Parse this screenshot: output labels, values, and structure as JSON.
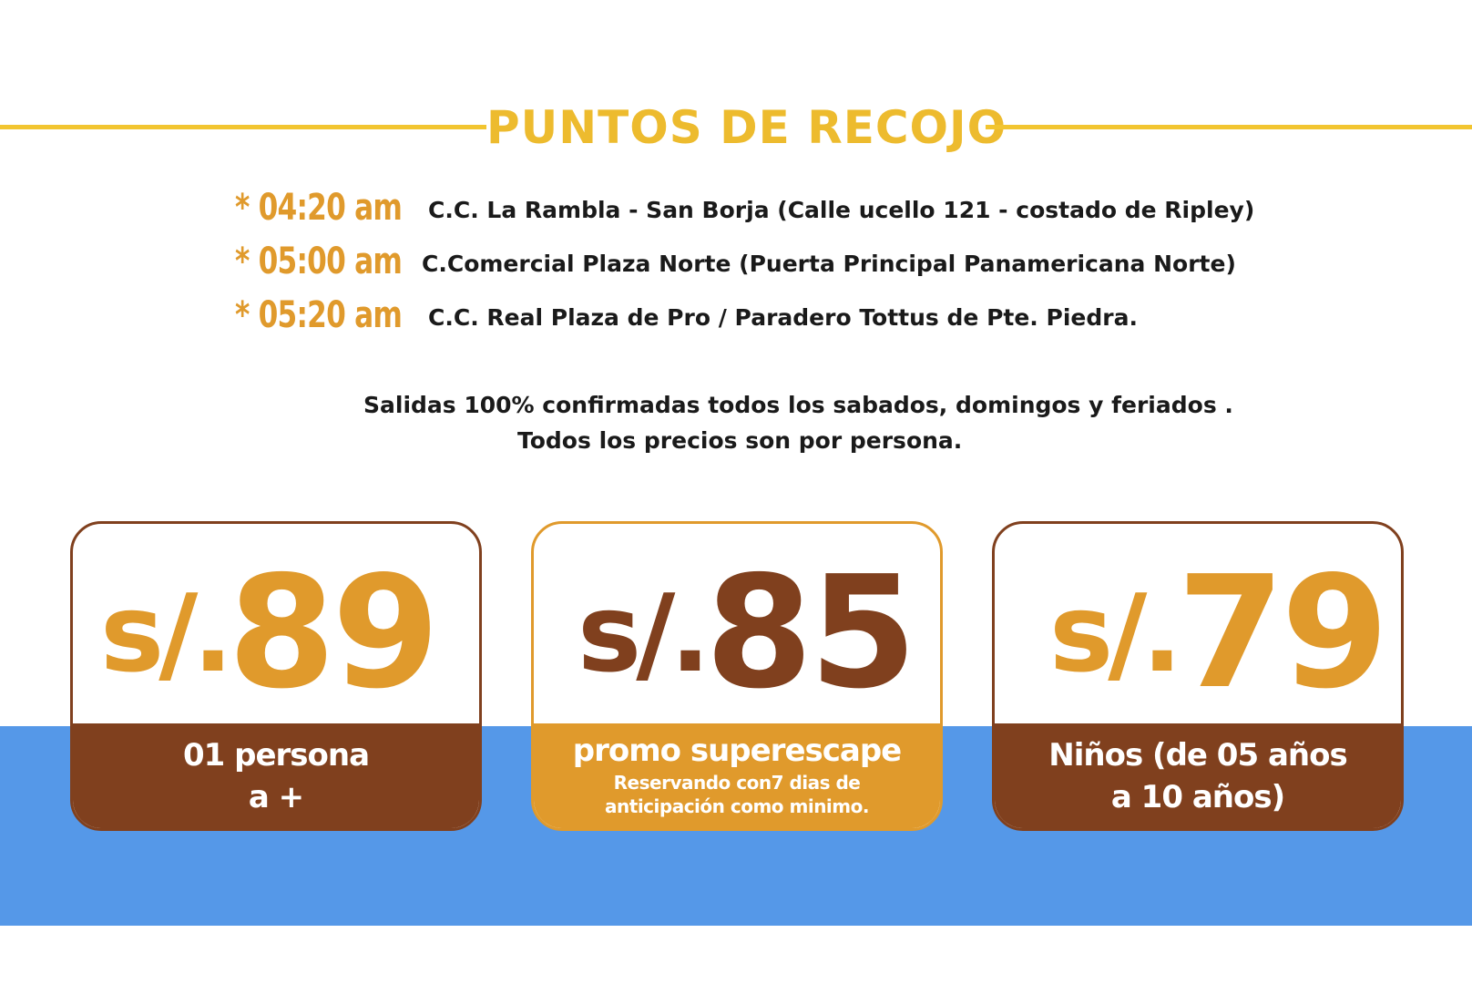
{
  "colors": {
    "gold": "#edbb2e",
    "orange": "#e09a2c",
    "brown": "#80401e",
    "blue": "#5598e8"
  },
  "header": {
    "title": "PUNTOS DE RECOJO"
  },
  "pickups": [
    {
      "time": "* 04:20 am",
      "place": "C.C. La Rambla - San Borja (Calle ucello 121 - costado de Ripley)"
    },
    {
      "time": "* 05:00 am",
      "place": "C.Comercial Plaza Norte (Puerta Principal Panamericana  Norte)"
    },
    {
      "time": "* 05:20 am",
      "place": "C.C. Real Plaza de Pro / Paradero Tottus de Pte. Piedra."
    }
  ],
  "notes": {
    "line1": "Salidas 100% confirmadas todos los sabados, domingos y feriados .",
    "line2": "Todos los precios son por persona."
  },
  "prices": [
    {
      "currency": "s/.",
      "amount": "89",
      "label": "01 persona",
      "label2": "a +"
    },
    {
      "currency": "s/.",
      "amount": "85",
      "label": "promo superescape",
      "label2": "Reservando con7 dias de",
      "label3": "anticipación como minimo."
    },
    {
      "currency": "s/.",
      "amount": "79",
      "label": "Niños (de 05 años",
      "label2": "a 10 años)"
    }
  ]
}
